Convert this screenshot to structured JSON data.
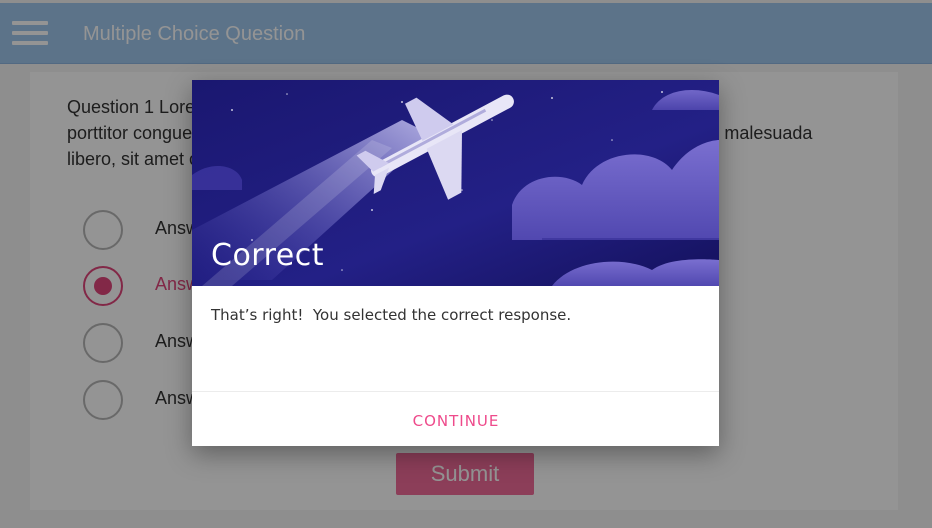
{
  "appbar": {
    "title": "Multiple Choice Question"
  },
  "question": {
    "lines": [
      "Question 1 Lorem ipsum dolor sit amet, consectetur adipiscing elit. Maecenas",
      "porttitor congue massa. Fusce posuere, magna sed pulvinar ultricies, purus lectus malesuada",
      "libero, sit amet commodo magna eros quis urna."
    ]
  },
  "answers": [
    {
      "label": "Answer 1",
      "selected": false
    },
    {
      "label": "Answer 2",
      "selected": true
    },
    {
      "label": "Answer 3",
      "selected": false
    },
    {
      "label": "Answer 4",
      "selected": false
    }
  ],
  "submit_label": "Submit",
  "dialog": {
    "title": "Correct",
    "message": "That’s right!  You selected the correct response.",
    "continue_label": "CONTINUE"
  },
  "colors": {
    "appbar": "#9fc6ec",
    "accent": "#e0457b",
    "submit": "#f26b99",
    "continue": "#ee4a8b",
    "dialog_header_bg": "#1d1a78"
  },
  "icons": {
    "menu": "hamburger-icon",
    "illustration": "airplane-illustration"
  }
}
